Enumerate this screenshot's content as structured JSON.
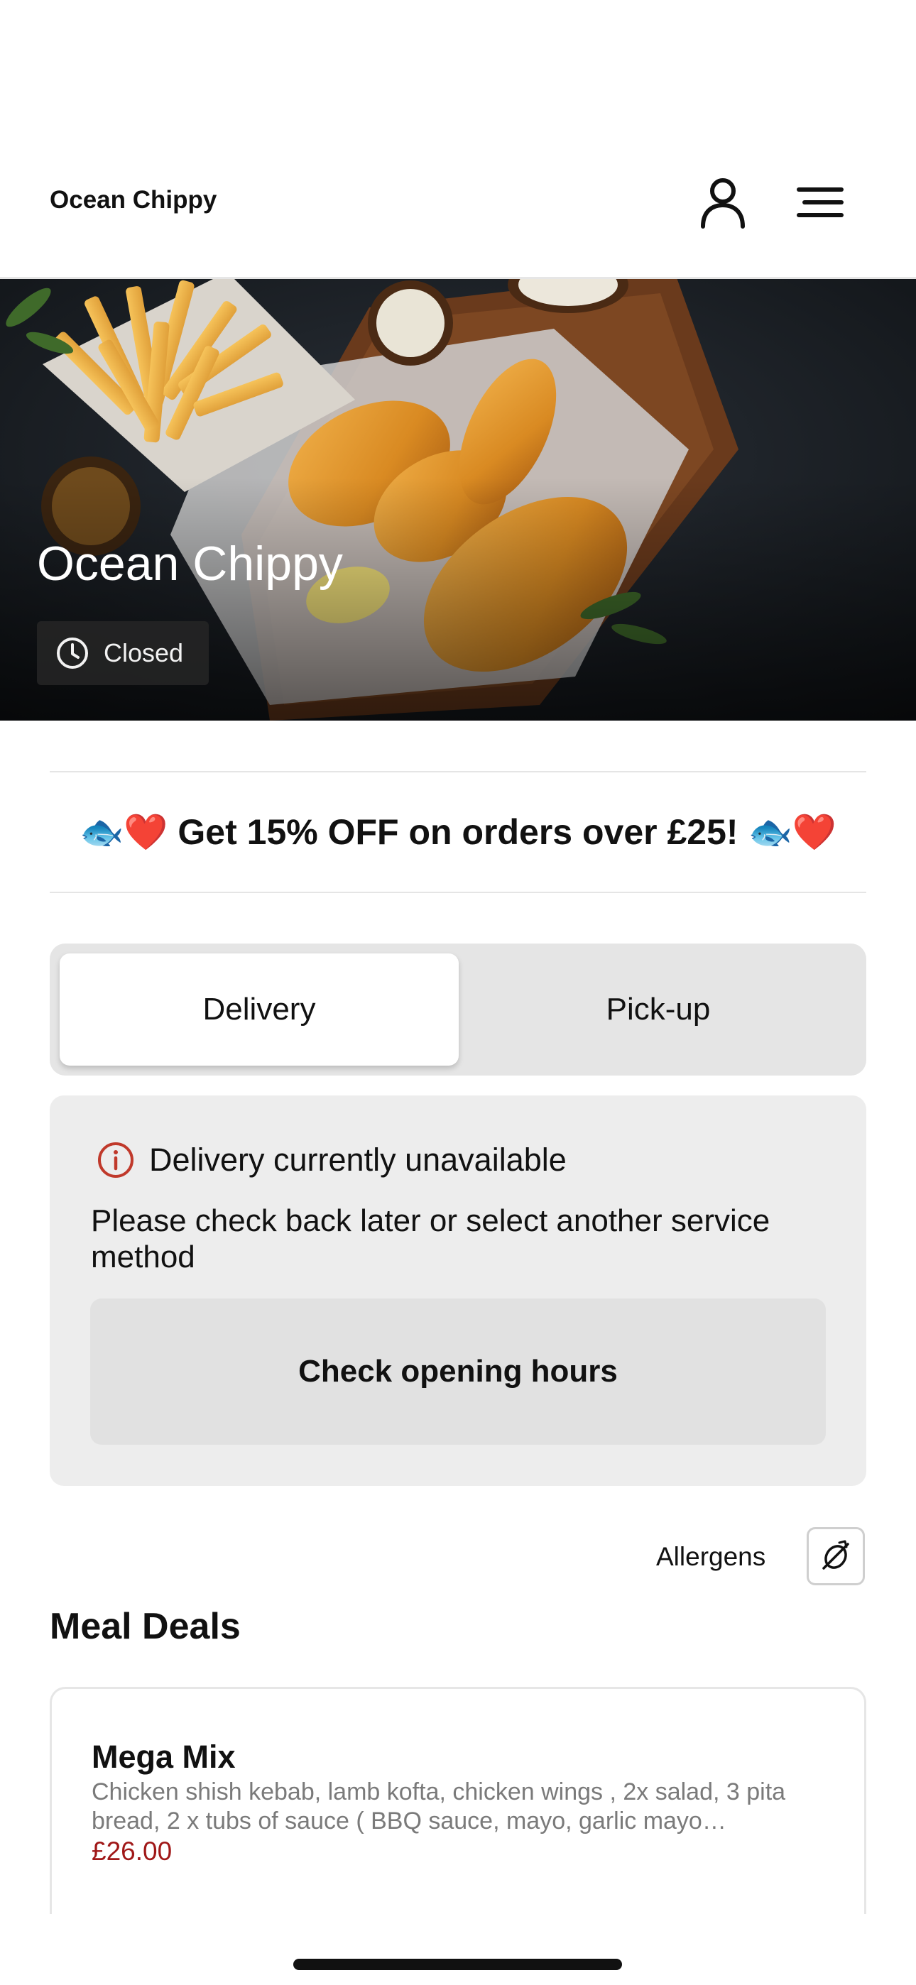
{
  "header": {
    "brand": "Ocean Chippy",
    "account_icon": "user-icon",
    "menu_icon": "hamburger-menu-icon"
  },
  "hero": {
    "title": "Ocean Chippy",
    "status": "Closed",
    "status_icon": "clock-icon",
    "image": "fish-and-chips-photo"
  },
  "promo": {
    "text": "🐟❤️ Get 15% OFF on orders over £25! 🐟❤️"
  },
  "service_toggle": {
    "options": [
      "Delivery",
      "Pick-up"
    ],
    "selected": "Delivery"
  },
  "notice": {
    "icon": "info-icon",
    "title": "Delivery currently unavailable",
    "body": "Please check back later or select another service method",
    "button": "Check opening hours"
  },
  "allergens": {
    "label": "Allergens",
    "icon": "allergen-peanut-icon"
  },
  "menu": {
    "section_title": "Meal Deals",
    "items": [
      {
        "name": "Mega Mix",
        "description": "Chicken shish kebab, lamb kofta, chicken wings , 2x salad, 3 pita bread, 2 x tubs of sauce ( BBQ sauce, mayo, garlic mayo…",
        "price": "£26.00"
      }
    ]
  },
  "colors": {
    "accent_price": "#a01818",
    "info_red": "#c0392b",
    "toggle_bg": "#e5e5e5",
    "notice_bg": "#ededed"
  }
}
